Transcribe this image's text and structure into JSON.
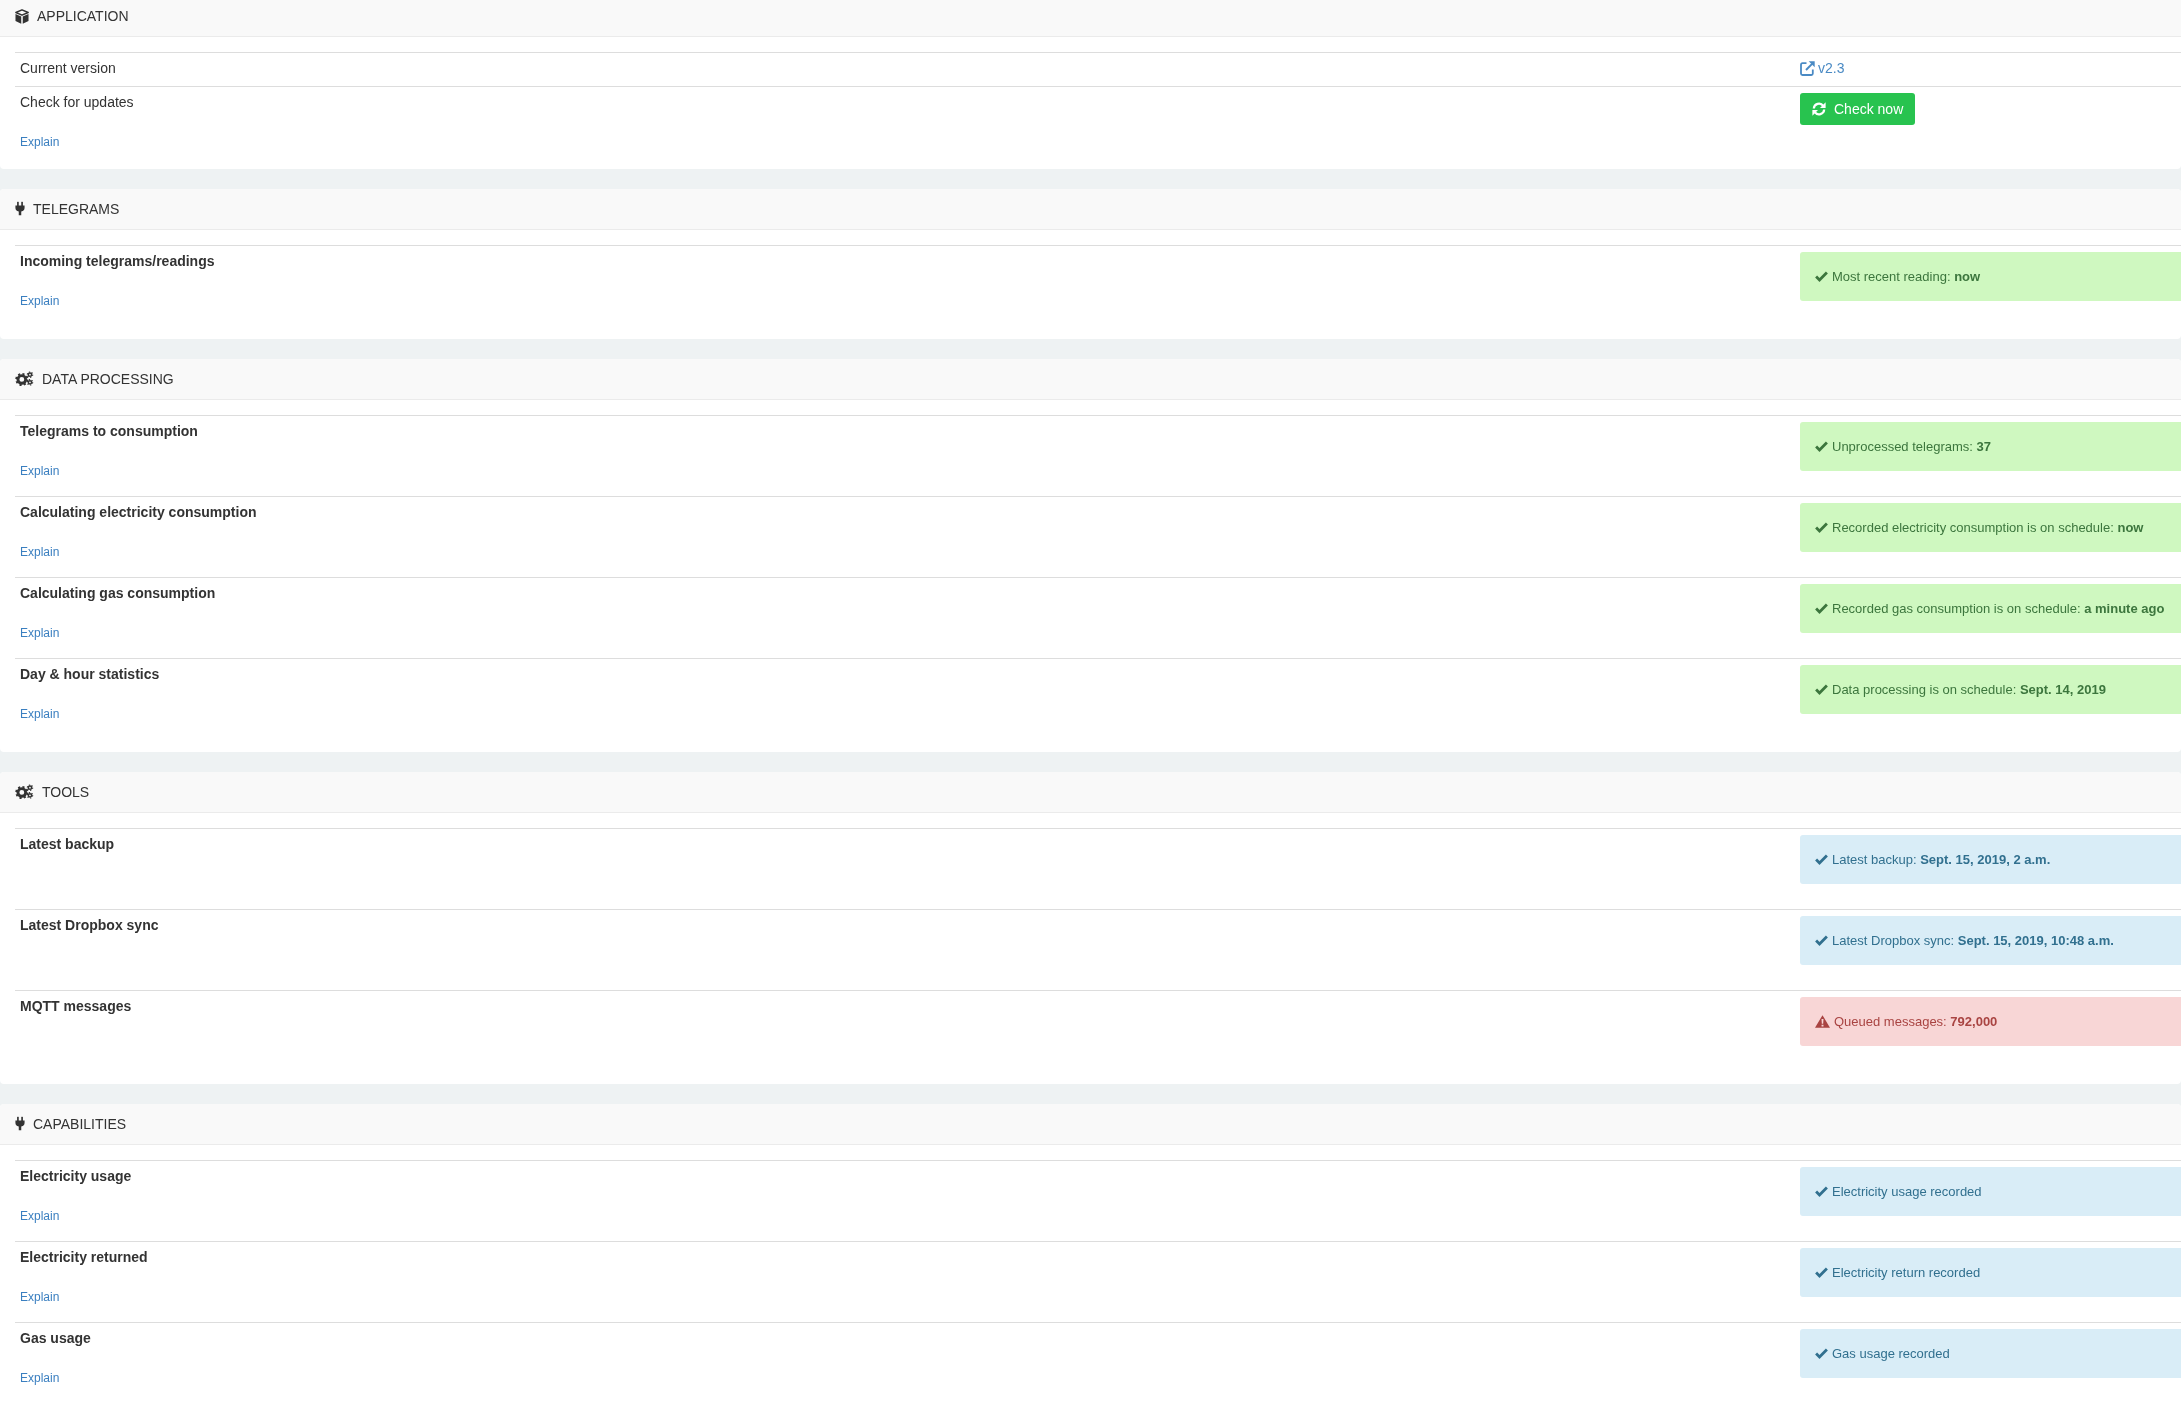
{
  "sections": [
    {
      "kind": "application",
      "title": "APPLICATION",
      "rows": [
        {
          "kind": "link",
          "label": "Current version",
          "value": "v2.3"
        },
        {
          "kind": "button",
          "label": "Check for updates",
          "button": "Check now",
          "explain": "Explain"
        }
      ]
    },
    {
      "kind": "data",
      "title": "TELEGRAMS",
      "rows": [
        {
          "kind": "success",
          "label": "Incoming telegrams/readings",
          "message": "Most recent reading: **now**",
          "explain": "Explain"
        }
      ]
    },
    {
      "kind": "process",
      "title": "DATA PROCESSING",
      "rows": [
        {
          "kind": "success",
          "label": "Telegrams to consumption",
          "message": "Unprocessed telegrams: **37**",
          "explain": "Explain"
        },
        {
          "kind": "success",
          "label": "Calculating electricity consumption",
          "message": "Recorded electricity consumption is on schedule: **now**",
          "explain": "Explain"
        },
        {
          "kind": "success",
          "label": "Calculating gas consumption",
          "message": "Recorded gas consumption is on schedule: **a minute ago**",
          "explain": "Explain"
        },
        {
          "kind": "success",
          "label": "Day & hour statistics",
          "message": "Data processing is on schedule: **Sept. 14, 2019**",
          "explain": "Explain"
        }
      ]
    },
    {
      "kind": "process",
      "title": "TOOLS",
      "rows": [
        {
          "kind": "info",
          "label": "Latest backup",
          "message": "Latest backup: **Sept. 15, 2019, 2 a.m.**"
        },
        {
          "kind": "info",
          "label": "Latest Dropbox sync",
          "message": "Latest Dropbox sync: **Sept. 15, 2019, 10:48 a.m.**"
        },
        {
          "kind": "danger",
          "label": "MQTT messages",
          "message": "Queued messages: **792,000**"
        }
      ]
    },
    {
      "kind": "data",
      "title": "CAPABILITIES",
      "rows": [
        {
          "kind": "info",
          "label": "Electricity usage",
          "message": "Electricity usage recorded",
          "explain": "Explain"
        },
        {
          "kind": "info",
          "label": "Electricity returned",
          "message": "Electricity return recorded",
          "explain": "Explain"
        },
        {
          "kind": "info",
          "label": "Gas usage",
          "message": "Gas usage recorded",
          "explain": "Explain"
        }
      ]
    }
  ]
}
